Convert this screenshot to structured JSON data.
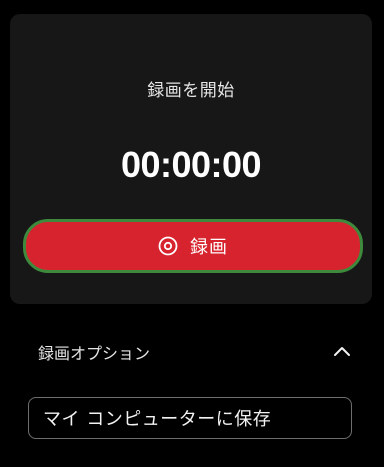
{
  "recorder": {
    "title": "録画を開始",
    "timer": "00:00:00",
    "record_button_label": "録画",
    "record_icon": "record-circle-icon"
  },
  "options": {
    "label": "録画オプション",
    "toggle_icon": "chevron-up-icon",
    "save_location": "マイ コンピューターに保存"
  },
  "colors": {
    "background": "#000000",
    "card": "#171717",
    "record_button": "#d7232e",
    "record_button_outline": "#3e8a3c"
  }
}
